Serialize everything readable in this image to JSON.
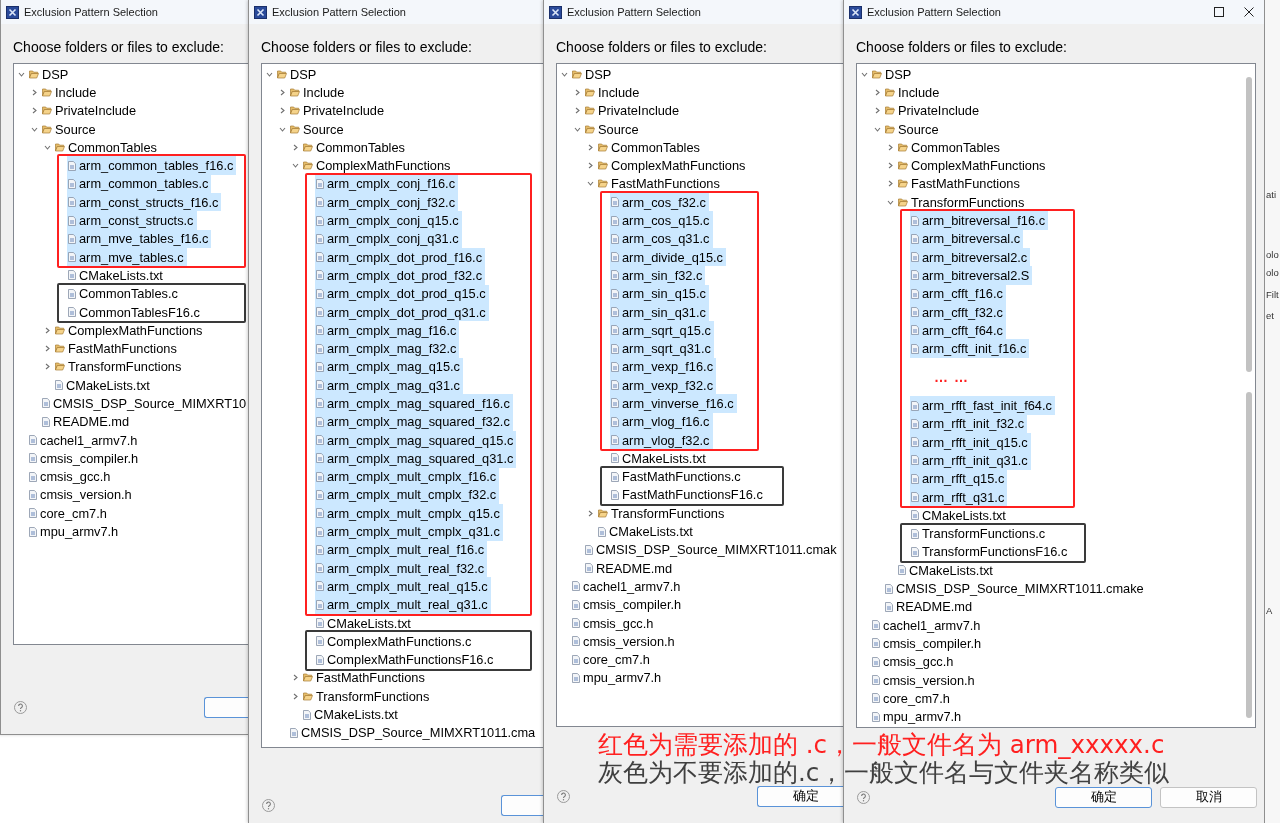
{
  "windows": [
    {
      "title": "Exclusion Pattern Selection",
      "prompt": "Choose folders or files to exclude:",
      "tree": [
        {
          "kind": "folder",
          "name": "DSP",
          "expanded": true,
          "selected": false,
          "children": [
            {
              "kind": "folder",
              "name": "Include",
              "expanded": false,
              "selected": false
            },
            {
              "kind": "folder",
              "name": "PrivateInclude",
              "expanded": false,
              "selected": false
            },
            {
              "kind": "folder",
              "name": "Source",
              "expanded": true,
              "selected": false,
              "children": [
                {
                  "kind": "folder",
                  "name": "CommonTables",
                  "expanded": true,
                  "selected": false,
                  "children": [
                    {
                      "kind": "frame",
                      "color": "#ff2020",
                      "items": [
                        {
                          "kind": "file",
                          "name": "arm_common_tables_f16.c",
                          "selected": true
                        },
                        {
                          "kind": "file",
                          "name": "arm_common_tables.c",
                          "selected": true
                        },
                        {
                          "kind": "file",
                          "name": "arm_const_structs_f16.c",
                          "selected": true
                        },
                        {
                          "kind": "file",
                          "name": "arm_const_structs.c",
                          "selected": true
                        },
                        {
                          "kind": "file",
                          "name": "arm_mve_tables_f16.c",
                          "selected": true
                        },
                        {
                          "kind": "file",
                          "name": "arm_mve_tables.c",
                          "selected": true
                        }
                      ]
                    },
                    {
                      "kind": "file",
                      "name": "CMakeLists.txt",
                      "selected": false
                    },
                    {
                      "kind": "frame",
                      "color": "#3a3a3a",
                      "items": [
                        {
                          "kind": "file",
                          "name": "CommonTables.c",
                          "selected": false
                        },
                        {
                          "kind": "file",
                          "name": "CommonTablesF16.c",
                          "selected": false
                        }
                      ]
                    }
                  ]
                },
                {
                  "kind": "folder",
                  "name": "ComplexMathFunctions",
                  "expanded": false,
                  "selected": false
                },
                {
                  "kind": "folder",
                  "name": "FastMathFunctions",
                  "expanded": false,
                  "selected": false
                },
                {
                  "kind": "folder",
                  "name": "TransformFunctions",
                  "expanded": false,
                  "selected": false
                },
                {
                  "kind": "file",
                  "name": "CMakeLists.txt",
                  "selected": false
                }
              ]
            },
            {
              "kind": "file",
              "name": "CMSIS_DSP_Source_MIMXRT10",
              "selected": false
            },
            {
              "kind": "file",
              "name": "README.md",
              "selected": false
            }
          ]
        },
        {
          "kind": "file",
          "name": "cachel1_armv7.h",
          "selected": false
        },
        {
          "kind": "file",
          "name": "cmsis_compiler.h",
          "selected": false
        },
        {
          "kind": "file",
          "name": "cmsis_gcc.h",
          "selected": false
        },
        {
          "kind": "file",
          "name": "cmsis_version.h",
          "selected": false
        },
        {
          "kind": "file",
          "name": "core_cm7.h",
          "selected": false
        },
        {
          "kind": "file",
          "name": "mpu_armv7.h",
          "selected": false
        }
      ],
      "buttons": [
        {
          "default": true
        }
      ]
    },
    {
      "title": "Exclusion Pattern Selection",
      "prompt": "Choose folders or files to exclude:",
      "tree": [
        {
          "kind": "folder",
          "name": "DSP",
          "expanded": true,
          "selected": false,
          "children": [
            {
              "kind": "folder",
              "name": "Include",
              "expanded": false,
              "selected": false
            },
            {
              "kind": "folder",
              "name": "PrivateInclude",
              "expanded": false,
              "selected": false
            },
            {
              "kind": "folder",
              "name": "Source",
              "expanded": true,
              "selected": false,
              "children": [
                {
                  "kind": "folder",
                  "name": "CommonTables",
                  "expanded": false,
                  "selected": false
                },
                {
                  "kind": "folder",
                  "name": "ComplexMathFunctions",
                  "expanded": true,
                  "selected": false,
                  "children": [
                    {
                      "kind": "frame",
                      "color": "#ff2020",
                      "items": [
                        {
                          "kind": "file",
                          "name": "arm_cmplx_conj_f16.c",
                          "selected": true
                        },
                        {
                          "kind": "file",
                          "name": "arm_cmplx_conj_f32.c",
                          "selected": true
                        },
                        {
                          "kind": "file",
                          "name": "arm_cmplx_conj_q15.c",
                          "selected": true
                        },
                        {
                          "kind": "file",
                          "name": "arm_cmplx_conj_q31.c",
                          "selected": true
                        },
                        {
                          "kind": "file",
                          "name": "arm_cmplx_dot_prod_f16.c",
                          "selected": true
                        },
                        {
                          "kind": "file",
                          "name": "arm_cmplx_dot_prod_f32.c",
                          "selected": true
                        },
                        {
                          "kind": "file",
                          "name": "arm_cmplx_dot_prod_q15.c",
                          "selected": true
                        },
                        {
                          "kind": "file",
                          "name": "arm_cmplx_dot_prod_q31.c",
                          "selected": true
                        },
                        {
                          "kind": "file",
                          "name": "arm_cmplx_mag_f16.c",
                          "selected": true
                        },
                        {
                          "kind": "file",
                          "name": "arm_cmplx_mag_f32.c",
                          "selected": true
                        },
                        {
                          "kind": "file",
                          "name": "arm_cmplx_mag_q15.c",
                          "selected": true
                        },
                        {
                          "kind": "file",
                          "name": "arm_cmplx_mag_q31.c",
                          "selected": true
                        },
                        {
                          "kind": "file",
                          "name": "arm_cmplx_mag_squared_f16.c",
                          "selected": true
                        },
                        {
                          "kind": "file",
                          "name": "arm_cmplx_mag_squared_f32.c",
                          "selected": true
                        },
                        {
                          "kind": "file",
                          "name": "arm_cmplx_mag_squared_q15.c",
                          "selected": true
                        },
                        {
                          "kind": "file",
                          "name": "arm_cmplx_mag_squared_q31.c",
                          "selected": true
                        },
                        {
                          "kind": "file",
                          "name": "arm_cmplx_mult_cmplx_f16.c",
                          "selected": true
                        },
                        {
                          "kind": "file",
                          "name": "arm_cmplx_mult_cmplx_f32.c",
                          "selected": true
                        },
                        {
                          "kind": "file",
                          "name": "arm_cmplx_mult_cmplx_q15.c",
                          "selected": true
                        },
                        {
                          "kind": "file",
                          "name": "arm_cmplx_mult_cmplx_q31.c",
                          "selected": true
                        },
                        {
                          "kind": "file",
                          "name": "arm_cmplx_mult_real_f16.c",
                          "selected": true
                        },
                        {
                          "kind": "file",
                          "name": "arm_cmplx_mult_real_f32.c",
                          "selected": true
                        },
                        {
                          "kind": "file",
                          "name": "arm_cmplx_mult_real_q15.c",
                          "selected": true
                        },
                        {
                          "kind": "file",
                          "name": "arm_cmplx_mult_real_q31.c",
                          "selected": true
                        }
                      ]
                    },
                    {
                      "kind": "file",
                      "name": "CMakeLists.txt",
                      "selected": false
                    },
                    {
                      "kind": "frame",
                      "color": "#3a3a3a",
                      "items": [
                        {
                          "kind": "file",
                          "name": "ComplexMathFunctions.c",
                          "selected": false
                        },
                        {
                          "kind": "file",
                          "name": "ComplexMathFunctionsF16.c",
                          "selected": false
                        }
                      ]
                    }
                  ]
                },
                {
                  "kind": "folder",
                  "name": "FastMathFunctions",
                  "expanded": false,
                  "selected": false
                },
                {
                  "kind": "folder",
                  "name": "TransformFunctions",
                  "expanded": false,
                  "selected": false
                },
                {
                  "kind": "file",
                  "name": "CMakeLists.txt",
                  "selected": false
                }
              ]
            },
            {
              "kind": "file",
              "name": "CMSIS_DSP_Source_MIMXRT1011.cma",
              "selected": false
            }
          ]
        }
      ],
      "buttons": [
        {
          "default": true
        }
      ]
    },
    {
      "title": "Exclusion Pattern Selection",
      "prompt": "Choose folders or files to exclude:",
      "tree": [
        {
          "kind": "folder",
          "name": "DSP",
          "expanded": true,
          "selected": false,
          "children": [
            {
              "kind": "folder",
              "name": "Include",
              "expanded": false,
              "selected": false
            },
            {
              "kind": "folder",
              "name": "PrivateInclude",
              "expanded": false,
              "selected": false
            },
            {
              "kind": "folder",
              "name": "Source",
              "expanded": true,
              "selected": false,
              "children": [
                {
                  "kind": "folder",
                  "name": "CommonTables",
                  "expanded": false,
                  "selected": false
                },
                {
                  "kind": "folder",
                  "name": "ComplexMathFunctions",
                  "expanded": false,
                  "selected": false
                },
                {
                  "kind": "folder",
                  "name": "FastMathFunctions",
                  "expanded": true,
                  "selected": false,
                  "children": [
                    {
                      "kind": "frame",
                      "color": "#ff2020",
                      "items": [
                        {
                          "kind": "file",
                          "name": "arm_cos_f32.c",
                          "selected": true
                        },
                        {
                          "kind": "file",
                          "name": "arm_cos_q15.c",
                          "selected": true
                        },
                        {
                          "kind": "file",
                          "name": "arm_cos_q31.c",
                          "selected": true
                        },
                        {
                          "kind": "file",
                          "name": "arm_divide_q15.c",
                          "selected": true
                        },
                        {
                          "kind": "file",
                          "name": "arm_sin_f32.c",
                          "selected": true
                        },
                        {
                          "kind": "file",
                          "name": "arm_sin_q15.c",
                          "selected": true
                        },
                        {
                          "kind": "file",
                          "name": "arm_sin_q31.c",
                          "selected": true
                        },
                        {
                          "kind": "file",
                          "name": "arm_sqrt_q15.c",
                          "selected": true
                        },
                        {
                          "kind": "file",
                          "name": "arm_sqrt_q31.c",
                          "selected": true
                        },
                        {
                          "kind": "file",
                          "name": "arm_vexp_f16.c",
                          "selected": true
                        },
                        {
                          "kind": "file",
                          "name": "arm_vexp_f32.c",
                          "selected": true
                        },
                        {
                          "kind": "file",
                          "name": "arm_vinverse_f16.c",
                          "selected": true
                        },
                        {
                          "kind": "file",
                          "name": "arm_vlog_f16.c",
                          "selected": true
                        },
                        {
                          "kind": "file",
                          "name": "arm_vlog_f32.c",
                          "selected": true
                        }
                      ]
                    },
                    {
                      "kind": "file",
                      "name": "CMakeLists.txt",
                      "selected": false
                    },
                    {
                      "kind": "frame",
                      "color": "#3a3a3a",
                      "items": [
                        {
                          "kind": "file",
                          "name": "FastMathFunctions.c",
                          "selected": false
                        },
                        {
                          "kind": "file",
                          "name": "FastMathFunctionsF16.c",
                          "selected": false
                        }
                      ]
                    }
                  ]
                },
                {
                  "kind": "folder",
                  "name": "TransformFunctions",
                  "expanded": false,
                  "selected": false
                },
                {
                  "kind": "file",
                  "name": "CMakeLists.txt",
                  "selected": false
                }
              ]
            },
            {
              "kind": "file",
              "name": "CMSIS_DSP_Source_MIMXRT1011.cmak",
              "selected": false
            },
            {
              "kind": "file",
              "name": "README.md",
              "selected": false
            }
          ]
        },
        {
          "kind": "file",
          "name": "cachel1_armv7.h",
          "selected": false
        },
        {
          "kind": "file",
          "name": "cmsis_compiler.h",
          "selected": false
        },
        {
          "kind": "file",
          "name": "cmsis_gcc.h",
          "selected": false
        },
        {
          "kind": "file",
          "name": "cmsis_version.h",
          "selected": false
        },
        {
          "kind": "file",
          "name": "core_cm7.h",
          "selected": false
        },
        {
          "kind": "file",
          "name": "mpu_armv7.h",
          "selected": false
        }
      ],
      "buttons": [
        {
          "label": "确定",
          "default": true
        }
      ]
    },
    {
      "title": "Exclusion Pattern Selection",
      "title_buttons": [
        {
          "kind": "maximize"
        },
        {
          "kind": "close"
        }
      ],
      "prompt": "Choose folders or files to exclude:",
      "tree": [
        {
          "kind": "folder",
          "name": "DSP",
          "expanded": true,
          "selected": false,
          "children": [
            {
              "kind": "folder",
              "name": "Include",
              "expanded": false,
              "selected": false
            },
            {
              "kind": "folder",
              "name": "PrivateInclude",
              "expanded": false,
              "selected": false
            },
            {
              "kind": "folder",
              "name": "Source",
              "expanded": true,
              "selected": false,
              "children": [
                {
                  "kind": "folder",
                  "name": "CommonTables",
                  "expanded": false,
                  "selected": false
                },
                {
                  "kind": "folder",
                  "name": "ComplexMathFunctions",
                  "expanded": false,
                  "selected": false
                },
                {
                  "kind": "folder",
                  "name": "FastMathFunctions",
                  "expanded": false,
                  "selected": false
                },
                {
                  "kind": "folder",
                  "name": "TransformFunctions",
                  "expanded": true,
                  "selected": false,
                  "children": [
                    {
                      "kind": "frame",
                      "color": "#ff2020",
                      "items": [
                        {
                          "kind": "file",
                          "name": "arm_bitreversal_f16.c",
                          "selected": true
                        },
                        {
                          "kind": "file",
                          "name": "arm_bitreversal.c",
                          "selected": true
                        },
                        {
                          "kind": "file",
                          "name": "arm_bitreversal2.c",
                          "selected": true
                        },
                        {
                          "kind": "file",
                          "name": "arm_bitreversal2.S",
                          "selected": true
                        },
                        {
                          "kind": "file",
                          "name": "arm_cfft_f16.c",
                          "selected": true
                        },
                        {
                          "kind": "file",
                          "name": "arm_cfft_f32.c",
                          "selected": true
                        },
                        {
                          "kind": "file",
                          "name": "arm_cfft_f64.c",
                          "selected": true
                        },
                        {
                          "kind": "file",
                          "name": "arm_cfft_init_f16.c",
                          "selected": true
                        },
                        {
                          "kind": "ellipsis",
                          "name": "… …"
                        },
                        {
                          "kind": "file",
                          "name": "arm_rfft_fast_init_f64.c",
                          "selected": true
                        },
                        {
                          "kind": "file",
                          "name": "arm_rfft_init_f32.c",
                          "selected": true
                        },
                        {
                          "kind": "file",
                          "name": "arm_rfft_init_q15.c",
                          "selected": true
                        },
                        {
                          "kind": "file",
                          "name": "arm_rfft_init_q31.c",
                          "selected": true
                        },
                        {
                          "kind": "file",
                          "name": "arm_rfft_q15.c",
                          "selected": true
                        },
                        {
                          "kind": "file",
                          "name": "arm_rfft_q31.c",
                          "selected": true
                        }
                      ]
                    },
                    {
                      "kind": "file",
                      "name": "CMakeLists.txt",
                      "selected": false
                    },
                    {
                      "kind": "frame",
                      "color": "#3a3a3a",
                      "items": [
                        {
                          "kind": "file",
                          "name": "TransformFunctions.c",
                          "selected": false
                        },
                        {
                          "kind": "file",
                          "name": "TransformFunctionsF16.c",
                          "selected": false
                        }
                      ]
                    }
                  ]
                },
                {
                  "kind": "file",
                  "name": "CMakeLists.txt",
                  "selected": false
                }
              ]
            },
            {
              "kind": "file",
              "name": "CMSIS_DSP_Source_MIMXRT1011.cmake",
              "selected": false
            },
            {
              "kind": "file",
              "name": "README.md",
              "selected": false
            }
          ]
        },
        {
          "kind": "file",
          "name": "cachel1_armv7.h",
          "selected": false
        },
        {
          "kind": "file",
          "name": "cmsis_compiler.h",
          "selected": false
        },
        {
          "kind": "file",
          "name": "cmsis_gcc.h",
          "selected": false
        },
        {
          "kind": "file",
          "name": "cmsis_version.h",
          "selected": false
        },
        {
          "kind": "file",
          "name": "core_cm7.h",
          "selected": false
        },
        {
          "kind": "file",
          "name": "mpu_armv7.h",
          "selected": false
        }
      ],
      "buttons": [
        {
          "label": "确定",
          "default": true
        },
        {
          "label": "取消",
          "default": false
        }
      ]
    }
  ],
  "background_window": {
    "texts": [
      "ati",
      "olo",
      "olo",
      "Filt",
      "et",
      "A"
    ]
  },
  "annotations": [
    {
      "text": "红色为需要添加的 .c，一般文件名为 arm_xxxxx.c",
      "color": "#ff2020"
    },
    {
      "text": "灰色为不要添加的.c，一般文件名与文件夹名称类似",
      "color": "#404040"
    }
  ]
}
